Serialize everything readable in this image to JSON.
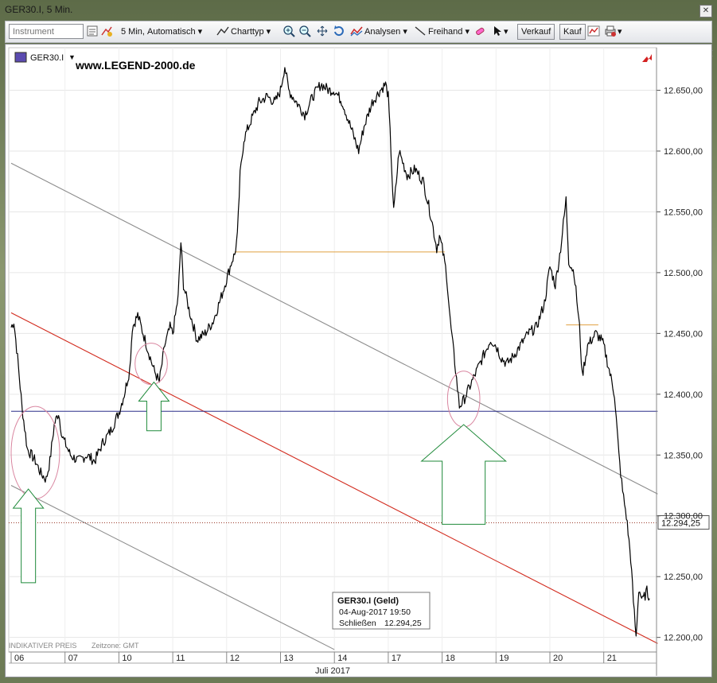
{
  "window": {
    "title": "GER30.I, 5 Min."
  },
  "toolbar": {
    "instrument_placeholder": "Instrument",
    "interval_label": "5 Min,",
    "mode_label": "Automatisch",
    "charttype_label": "Charttyp",
    "analysen_label": "Analysen",
    "freihand_label": "Freihand",
    "verkauf_label": "Verkauf",
    "kauf_label": "Kauf"
  },
  "colors": {
    "price_line": "#000000",
    "channel_gray": "#8c8c8c",
    "channel_red": "#d22b1e",
    "support_blue": "#2b2f8a",
    "last_price_dotted": "#9b3a2a",
    "gap_orange": "#e0a040",
    "arrow_green": "#1f8a3a",
    "circle_pink": "#d986a0"
  },
  "chart_data": {
    "type": "line",
    "instrument_label": "GER30.I",
    "watermark": "www.LEGEND-2000.de",
    "footer_note": "INDIKATIVER PREIS",
    "timezone_note": "Zeitzone: GMT",
    "month_label": "Juli 2017",
    "ylim": [
      12188,
      12685
    ],
    "yticks": [
      12200,
      12250,
      12300,
      12350,
      12400,
      12450,
      12500,
      12550,
      12600,
      12650
    ],
    "ytick_labels": [
      "12.200,00",
      "12.250,00",
      "12.300,00",
      "12.350,00",
      "12.400,00",
      "12.450,00",
      "12.500,00",
      "12.550,00",
      "12.600,00",
      "12.650,00"
    ],
    "days": [
      "06",
      "07",
      "10",
      "11",
      "12",
      "13",
      "14",
      "17",
      "18",
      "19",
      "20",
      "21"
    ],
    "last_price": 12294.25,
    "last_price_label": "12.294,25",
    "tooltip": {
      "title": "GER30.I (Geld)",
      "datetime": "04-Aug-2017 19:50",
      "close_label": "Schließen",
      "close_value": "12.294,25"
    },
    "series": [
      {
        "points": [
          [
            0.0,
            12455
          ],
          [
            0.05,
            12460
          ],
          [
            0.12,
            12430
          ],
          [
            0.2,
            12390
          ],
          [
            0.3,
            12355
          ],
          [
            0.45,
            12345
          ],
          [
            0.55,
            12335
          ],
          [
            0.65,
            12330
          ],
          [
            0.72,
            12345
          ],
          [
            0.8,
            12375
          ],
          [
            0.88,
            12385
          ],
          [
            0.95,
            12365
          ],
          [
            1.0,
            12360
          ],
          [
            1.1,
            12350
          ],
          [
            1.25,
            12345
          ],
          [
            1.4,
            12350
          ],
          [
            1.55,
            12345
          ],
          [
            1.7,
            12360
          ],
          [
            1.85,
            12370
          ],
          [
            2.0,
            12385
          ],
          [
            2.1,
            12400
          ],
          [
            2.2,
            12420
          ],
          [
            2.25,
            12455
          ],
          [
            2.35,
            12465
          ],
          [
            2.45,
            12450
          ],
          [
            2.55,
            12435
          ],
          [
            2.65,
            12420
          ],
          [
            2.75,
            12410
          ],
          [
            2.85,
            12440
          ],
          [
            2.95,
            12455
          ],
          [
            3.0,
            12450
          ],
          [
            3.1,
            12480
          ],
          [
            3.15,
            12525
          ],
          [
            3.2,
            12490
          ],
          [
            3.3,
            12470
          ],
          [
            3.45,
            12445
          ],
          [
            3.6,
            12450
          ],
          [
            3.75,
            12460
          ],
          [
            3.9,
            12480
          ],
          [
            4.0,
            12495
          ],
          [
            4.1,
            12510
          ],
          [
            4.15,
            12515
          ],
          [
            4.2,
            12530
          ],
          [
            4.25,
            12580
          ],
          [
            4.32,
            12610
          ],
          [
            4.45,
            12625
          ],
          [
            4.6,
            12640
          ],
          [
            4.75,
            12645
          ],
          [
            4.9,
            12640
          ],
          [
            5.0,
            12650
          ],
          [
            5.08,
            12670
          ],
          [
            5.15,
            12650
          ],
          [
            5.3,
            12640
          ],
          [
            5.45,
            12630
          ],
          [
            5.6,
            12645
          ],
          [
            5.75,
            12655
          ],
          [
            5.9,
            12650
          ],
          [
            6.0,
            12650
          ],
          [
            6.15,
            12640
          ],
          [
            6.3,
            12620
          ],
          [
            6.45,
            12600
          ],
          [
            6.55,
            12620
          ],
          [
            6.7,
            12640
          ],
          [
            6.85,
            12650
          ],
          [
            6.95,
            12655
          ],
          [
            7.0,
            12645
          ],
          [
            7.05,
            12600
          ],
          [
            7.1,
            12550
          ],
          [
            7.2,
            12600
          ],
          [
            7.35,
            12580
          ],
          [
            7.5,
            12585
          ],
          [
            7.65,
            12575
          ],
          [
            7.8,
            12545
          ],
          [
            7.9,
            12520
          ],
          [
            7.95,
            12530
          ],
          [
            8.0,
            12520
          ],
          [
            8.08,
            12500
          ],
          [
            8.15,
            12460
          ],
          [
            8.25,
            12420
          ],
          [
            8.32,
            12390
          ],
          [
            8.4,
            12395
          ],
          [
            8.5,
            12405
          ],
          [
            8.6,
            12415
          ],
          [
            8.75,
            12430
          ],
          [
            8.9,
            12445
          ],
          [
            9.0,
            12440
          ],
          [
            9.1,
            12430
          ],
          [
            9.2,
            12425
          ],
          [
            9.3,
            12430
          ],
          [
            9.45,
            12440
          ],
          [
            9.6,
            12450
          ],
          [
            9.75,
            12455
          ],
          [
            9.9,
            12475
          ],
          [
            10.0,
            12505
          ],
          [
            10.1,
            12490
          ],
          [
            10.2,
            12520
          ],
          [
            10.3,
            12560
          ],
          [
            10.35,
            12510
          ],
          [
            10.45,
            12500
          ],
          [
            10.55,
            12455
          ],
          [
            10.6,
            12415
          ],
          [
            10.7,
            12440
          ],
          [
            10.85,
            12450
          ],
          [
            10.95,
            12445
          ],
          [
            11.0,
            12440
          ],
          [
            11.1,
            12420
          ],
          [
            11.2,
            12400
          ],
          [
            11.28,
            12350
          ],
          [
            11.35,
            12320
          ],
          [
            11.42,
            12300
          ],
          [
            11.5,
            12265
          ],
          [
            11.55,
            12230
          ],
          [
            11.6,
            12200
          ],
          [
            11.65,
            12240
          ],
          [
            11.72,
            12230
          ],
          [
            11.8,
            12238
          ],
          [
            11.85,
            12232
          ]
        ]
      }
    ],
    "trendlines": [
      {
        "name": "upper-gray",
        "p1": [
          0.0,
          12590
        ],
        "p2": [
          12.0,
          12318
        ]
      },
      {
        "name": "red",
        "p1": [
          0.0,
          12467
        ],
        "p2": [
          12.0,
          12195
        ]
      },
      {
        "name": "lower-gray",
        "p1": [
          0.0,
          12325
        ],
        "p2": [
          6.0,
          12190
        ]
      }
    ],
    "hlines": [
      {
        "name": "support",
        "value": 12386,
        "from": 0.0,
        "to": 12.0
      },
      {
        "name": "gap-upper",
        "value": 12517,
        "from": 4.15,
        "to": 8.05
      },
      {
        "name": "gap-lower",
        "value": 12457,
        "from": 10.3,
        "to": 10.9
      }
    ],
    "circles": [
      {
        "cx": 0.45,
        "cy": 12352,
        "rx": 0.45,
        "ry": 38
      },
      {
        "cx": 2.6,
        "cy": 12425,
        "rx": 0.3,
        "ry": 17
      },
      {
        "cx": 8.4,
        "cy": 12396,
        "rx": 0.3,
        "ry": 23
      }
    ],
    "arrows": [
      {
        "x": 0.32,
        "base": 12245,
        "tip": 12322,
        "size": "small"
      },
      {
        "x": 2.65,
        "base": 12370,
        "tip": 12410,
        "size": "small"
      },
      {
        "x": 8.4,
        "base": 12293,
        "tip": 12375,
        "size": "large"
      }
    ]
  }
}
